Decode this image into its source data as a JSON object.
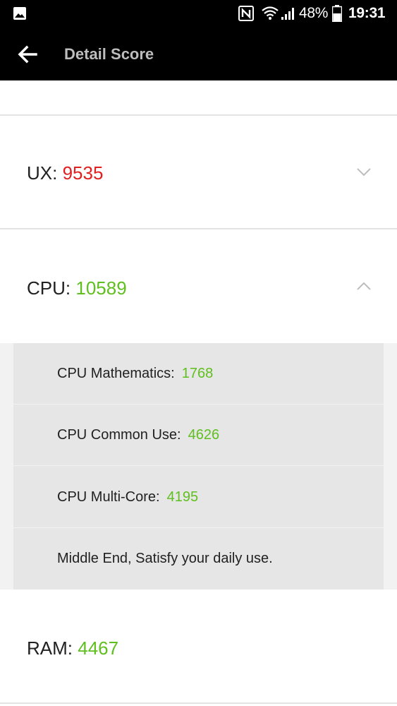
{
  "status_bar": {
    "battery_percent": "48%",
    "time": "19:31",
    "icons": [
      "image-notification-icon",
      "nfc-icon",
      "wifi-icon",
      "signal-icon",
      "battery-icon"
    ]
  },
  "app_bar": {
    "title": "Detail Score"
  },
  "scores": {
    "ux": {
      "label": "UX:",
      "value": "9535",
      "color": "#e02020",
      "expanded": false
    },
    "cpu": {
      "label": "CPU:",
      "value": "10589",
      "color": "#5fbf1e",
      "expanded": true
    },
    "ram": {
      "label": "RAM:",
      "value": "4467",
      "color": "#5fbf1e"
    }
  },
  "cpu_detail": {
    "items": [
      {
        "label": "CPU Mathematics:",
        "value": "1768"
      },
      {
        "label": "CPU Common Use:",
        "value": "4626"
      },
      {
        "label": "CPU Multi-Core:",
        "value": "4195"
      }
    ],
    "summary": "Middle End, Satisfy your daily use."
  },
  "colors": {
    "red": "#e02020",
    "green": "#5fbf1e",
    "app_bar": "#000000"
  }
}
